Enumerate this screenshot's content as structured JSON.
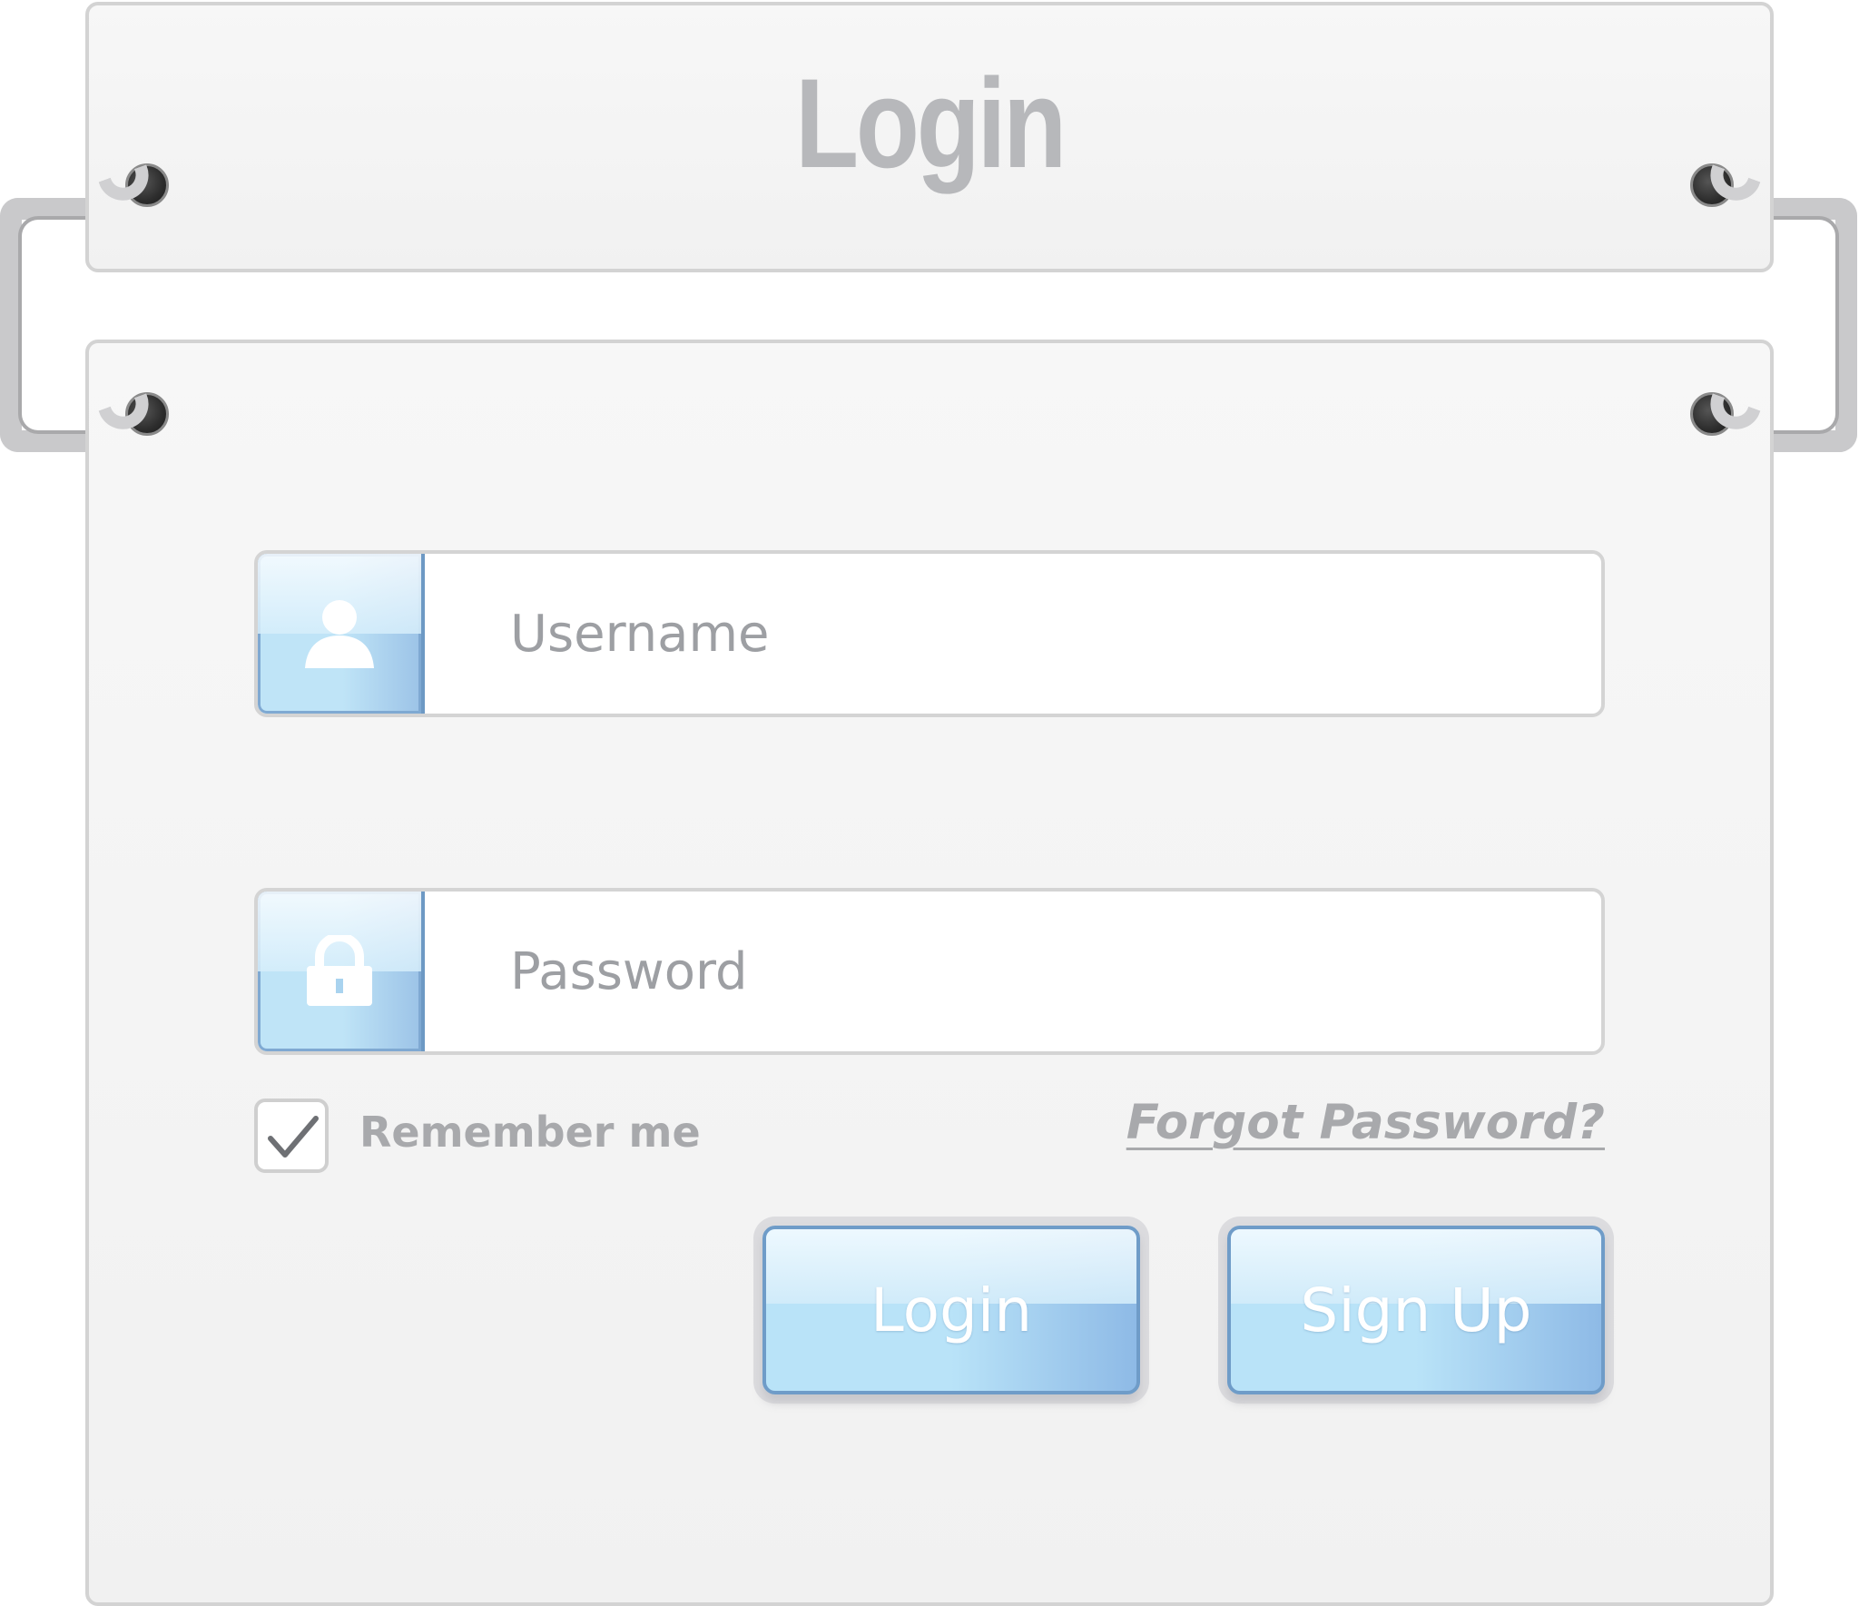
{
  "header": {
    "title": "Login"
  },
  "form": {
    "username": {
      "placeholder": "Username",
      "value": "",
      "icon": "user-icon"
    },
    "password": {
      "placeholder": "Password",
      "value": "",
      "icon": "lock-icon"
    },
    "remember": {
      "label": "Remember me",
      "checked": true,
      "icon": "checkmark-icon"
    },
    "forgot_label": "Forgot Password?",
    "login_label": "Login",
    "signup_label": "Sign Up"
  },
  "colors": {
    "accent_blue": "#b9e3f8",
    "accent_blue_dark": "#6f9cc8",
    "text_gray": "#a8a9ac",
    "panel_bg": "#f4f4f4"
  }
}
